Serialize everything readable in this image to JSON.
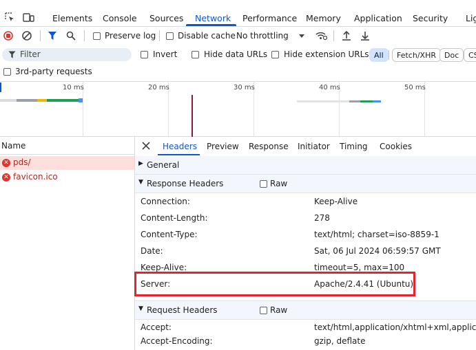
{
  "top_tabs": [
    "Elements",
    "Console",
    "Sources",
    "Network",
    "Performance",
    "Memory",
    "Application",
    "Security",
    "Lig"
  ],
  "toolbar": {
    "preserve_log": "Preserve log",
    "disable_cache": "Disable cache",
    "throttling": "No throttling"
  },
  "filter": {
    "placeholder": "Filter",
    "invert": "Invert",
    "hide_data_urls": "Hide data URLs",
    "hide_extension_urls": "Hide extension URLs",
    "type_pills": [
      "All",
      "Fetch/XHR",
      "Doc",
      "CS"
    ],
    "third_party": "3rd-party requests"
  },
  "overview": {
    "ticks": [
      "10 ms",
      "20 ms",
      "30 ms",
      "40 ms",
      "50 ms"
    ]
  },
  "requests": {
    "column": "Name",
    "items": [
      "pds/",
      "favicon.ico"
    ]
  },
  "detail_tabs": [
    "Headers",
    "Preview",
    "Response",
    "Initiator",
    "Timing",
    "Cookies"
  ],
  "general": {
    "title": "General"
  },
  "response_headers": {
    "title": "Response Headers",
    "raw": "Raw",
    "rows": [
      {
        "name": "Connection:",
        "value": "Keep-Alive"
      },
      {
        "name": "Content-Length:",
        "value": "278"
      },
      {
        "name": "Content-Type:",
        "value": "text/html; charset=iso-8859-1"
      },
      {
        "name": "Date:",
        "value": "Sat, 06 Jul 2024 06:59:57 GMT"
      },
      {
        "name": "Keep-Alive:",
        "value": "timeout=5, max=100"
      },
      {
        "name": "Server:",
        "value": "Apache/2.4.41 (Ubuntu)"
      }
    ]
  },
  "request_headers": {
    "title": "Request Headers",
    "raw": "Raw",
    "rows": [
      {
        "name": "Accept:",
        "value": "text/html,application/xhtml+xml,application"
      },
      {
        "name": "Accept-Encoding:",
        "value": "gzip, deflate"
      }
    ]
  },
  "colors": {
    "accent": "#0b57d0",
    "error": "#dc362e",
    "highlight": "#e8212b"
  }
}
